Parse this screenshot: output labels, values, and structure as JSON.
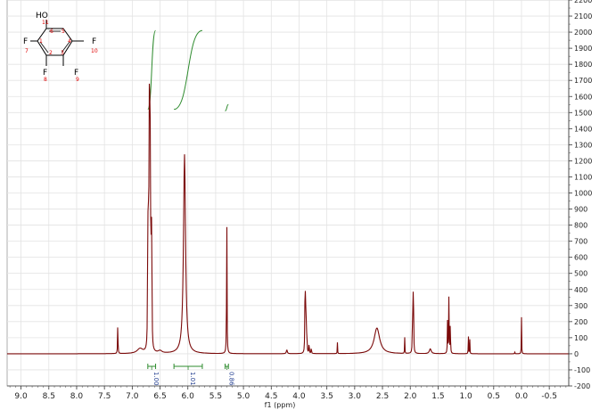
{
  "chart_data": {
    "type": "line",
    "xlabel": "f1 (ppm)",
    "ylabel": "",
    "x_reversed": true,
    "xlim": [
      9.25,
      -0.85
    ],
    "ylim": [
      -200,
      2200
    ],
    "x_ticks": [
      9.0,
      8.5,
      8.0,
      7.5,
      7.0,
      6.5,
      6.0,
      5.5,
      5.0,
      4.5,
      4.0,
      3.5,
      3.0,
      2.5,
      2.0,
      1.5,
      1.0,
      0.5,
      0.0,
      -0.5
    ],
    "x_tick_labels": [
      "9.0",
      "8.5",
      "8.0",
      "7.5",
      "7.0",
      "6.5",
      "6.0",
      "5.5",
      "5.0",
      "4.5",
      "4.0",
      "3.5",
      "3.0",
      "2.5",
      "2.0",
      "1.5",
      "1.0",
      "0.5",
      "0.0",
      "-0.5"
    ],
    "y_ticks": [
      -200,
      -100,
      0,
      100,
      200,
      300,
      400,
      500,
      600,
      700,
      800,
      900,
      1000,
      1100,
      1200,
      1300,
      1400,
      1500,
      1600,
      1700,
      1800,
      1900,
      2000,
      2100,
      2200
    ],
    "y_tick_labels": [
      "-200",
      "-100",
      "0",
      "100",
      "200",
      "300",
      "400",
      "500",
      "600",
      "700",
      "800",
      "900",
      "1000",
      "1100",
      "1200",
      "1300",
      "1400",
      "1500",
      "1600",
      "1700",
      "1800",
      "1900",
      "2000",
      "2100",
      "2200"
    ],
    "grid": true,
    "line_color": "#7b0a0a",
    "integral_color": "#2e8b2e",
    "integral_label_color": "#1f3b8f",
    "peaks": [
      {
        "ppm": 7.26,
        "height": 205,
        "width": 0.004
      },
      {
        "ppm": 6.86,
        "height": 30,
        "width": 0.06
      },
      {
        "ppm": 6.72,
        "height": 1050,
        "width": 0.004
      },
      {
        "ppm": 6.705,
        "height": 1350,
        "width": 0.004
      },
      {
        "ppm": 6.69,
        "height": 2050,
        "width": 0.004
      },
      {
        "ppm": 6.68,
        "height": 1800,
        "width": 0.004
      },
      {
        "ppm": 6.665,
        "height": 1000,
        "width": 0.004
      },
      {
        "ppm": 6.65,
        "height": 1020,
        "width": 0.004
      },
      {
        "ppm": 6.5,
        "height": 15,
        "width": 0.04
      },
      {
        "ppm": 6.06,
        "height": 1240,
        "width": 0.022
      },
      {
        "ppm": 5.3,
        "height": 950,
        "width": 0.004
      },
      {
        "ppm": 4.22,
        "height": 25,
        "width": 0.01
      },
      {
        "ppm": 3.895,
        "height": 260,
        "width": 0.004
      },
      {
        "ppm": 3.885,
        "height": 410,
        "width": 0.004
      },
      {
        "ppm": 3.875,
        "height": 300,
        "width": 0.004
      },
      {
        "ppm": 3.86,
        "height": 140,
        "width": 0.004
      },
      {
        "ppm": 3.82,
        "height": 80,
        "width": 0.004
      },
      {
        "ppm": 3.78,
        "height": 45,
        "width": 0.004
      },
      {
        "ppm": 3.31,
        "height": 70,
        "width": 0.003
      },
      {
        "ppm": 2.6,
        "height": 160,
        "width": 0.06
      },
      {
        "ppm": 2.1,
        "height": 100,
        "width": 0.003
      },
      {
        "ppm": 1.96,
        "height": 200,
        "width": 0.004
      },
      {
        "ppm": 1.95,
        "height": 440,
        "width": 0.004
      },
      {
        "ppm": 1.94,
        "height": 210,
        "width": 0.004
      },
      {
        "ppm": 1.64,
        "height": 30,
        "width": 0.02
      },
      {
        "ppm": 1.33,
        "height": 200,
        "width": 0.004
      },
      {
        "ppm": 1.305,
        "height": 380,
        "width": 0.004
      },
      {
        "ppm": 1.28,
        "height": 210,
        "width": 0.004
      },
      {
        "ppm": 0.955,
        "height": 130,
        "width": 0.003
      },
      {
        "ppm": 0.93,
        "height": 90,
        "width": 0.003
      },
      {
        "ppm": 0.12,
        "height": 10,
        "width": 0.004
      },
      {
        "ppm": 0.0,
        "height": 230,
        "width": 0.003
      }
    ],
    "integrals": [
      {
        "label": "1.00",
        "from": 6.72,
        "to": 6.58,
        "curve_low": 1520,
        "curve_high": 2010
      },
      {
        "label": "1.01",
        "from": 6.25,
        "to": 5.74,
        "curve_low": 1520,
        "curve_high": 2010
      },
      {
        "label": "0.86",
        "from": 5.33,
        "to": 5.27,
        "curve_low": 1510,
        "curve_high": 1550
      }
    ]
  },
  "molecule": {
    "atoms": [
      {
        "symbol": "HO",
        "number": "11"
      },
      {
        "symbol": "F",
        "number": "7"
      },
      {
        "symbol": "F",
        "number": "8"
      },
      {
        "symbol": "F",
        "number": "9"
      },
      {
        "symbol": "F",
        "number": "10"
      }
    ],
    "ring_numbers": [
      "6",
      "5",
      "1",
      "4",
      "2",
      "3"
    ]
  }
}
